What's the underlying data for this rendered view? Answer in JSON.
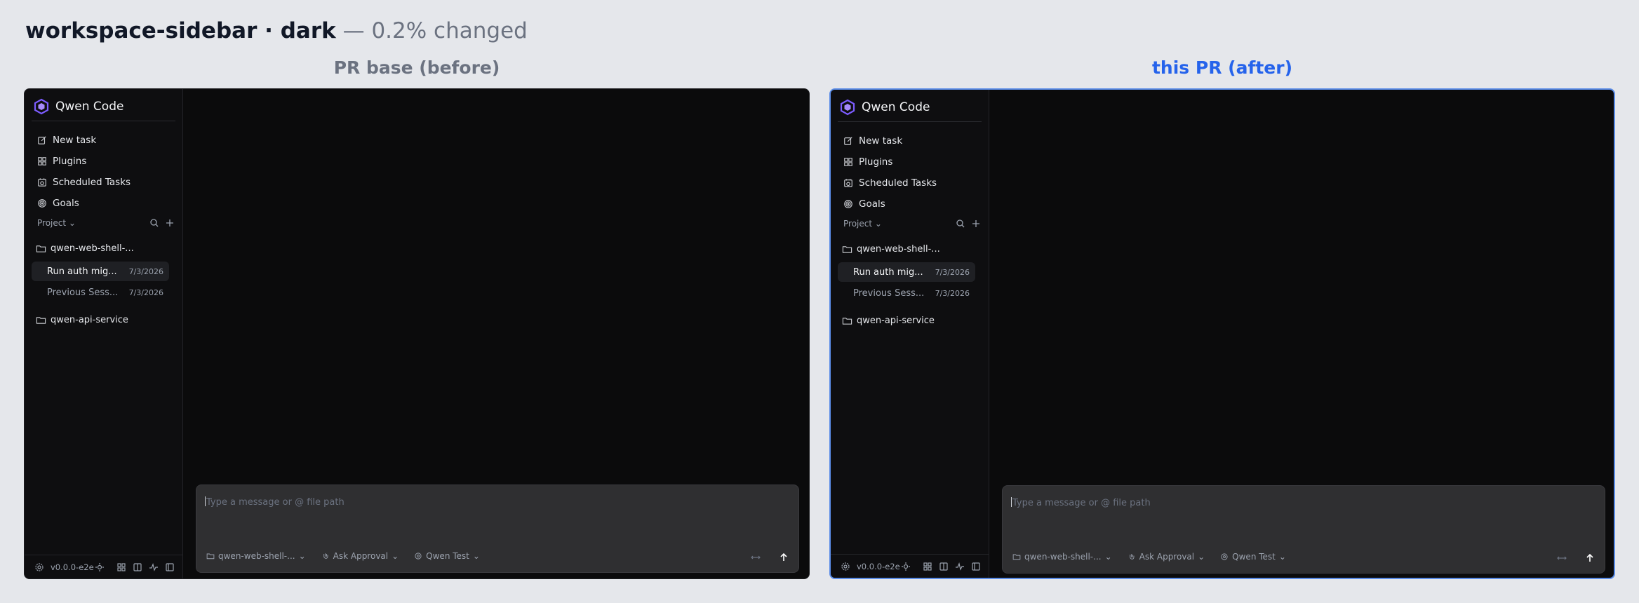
{
  "header": {
    "title": "workspace-sidebar · dark",
    "subtitle": "— 0.2% changed"
  },
  "columns": {
    "before_label": "PR base (before)",
    "after_label": "this PR (after)"
  },
  "app": {
    "brand": "Qwen Code",
    "nav": [
      {
        "label": "New task",
        "icon": "edit-icon"
      },
      {
        "label": "Plugins",
        "icon": "plugins-icon"
      },
      {
        "label": "Scheduled Tasks",
        "icon": "calendar-clock-icon"
      },
      {
        "label": "Goals",
        "icon": "target-icon"
      }
    ],
    "project_label": "Project",
    "folders": [
      {
        "name": "qwen-web-shell-..."
      },
      {
        "name": "qwen-api-service"
      }
    ],
    "sessions": [
      {
        "title": "Run auth mig...",
        "date": "7/3/2026",
        "active": true
      },
      {
        "title": "Previous Sess...",
        "date": "7/3/2026",
        "active": false
      }
    ],
    "version": "v0.0.0-e2e",
    "composer": {
      "placeholder": "Type a message or @ file path",
      "folder_chip": "qwen-web-shell-...",
      "approval_chip": "Ask Approval",
      "model_chip": "Qwen Test"
    }
  },
  "colors": {
    "accent_after": "#2563eb",
    "panel_bg": "#0b0b0c",
    "logo": "#7c5cff"
  }
}
